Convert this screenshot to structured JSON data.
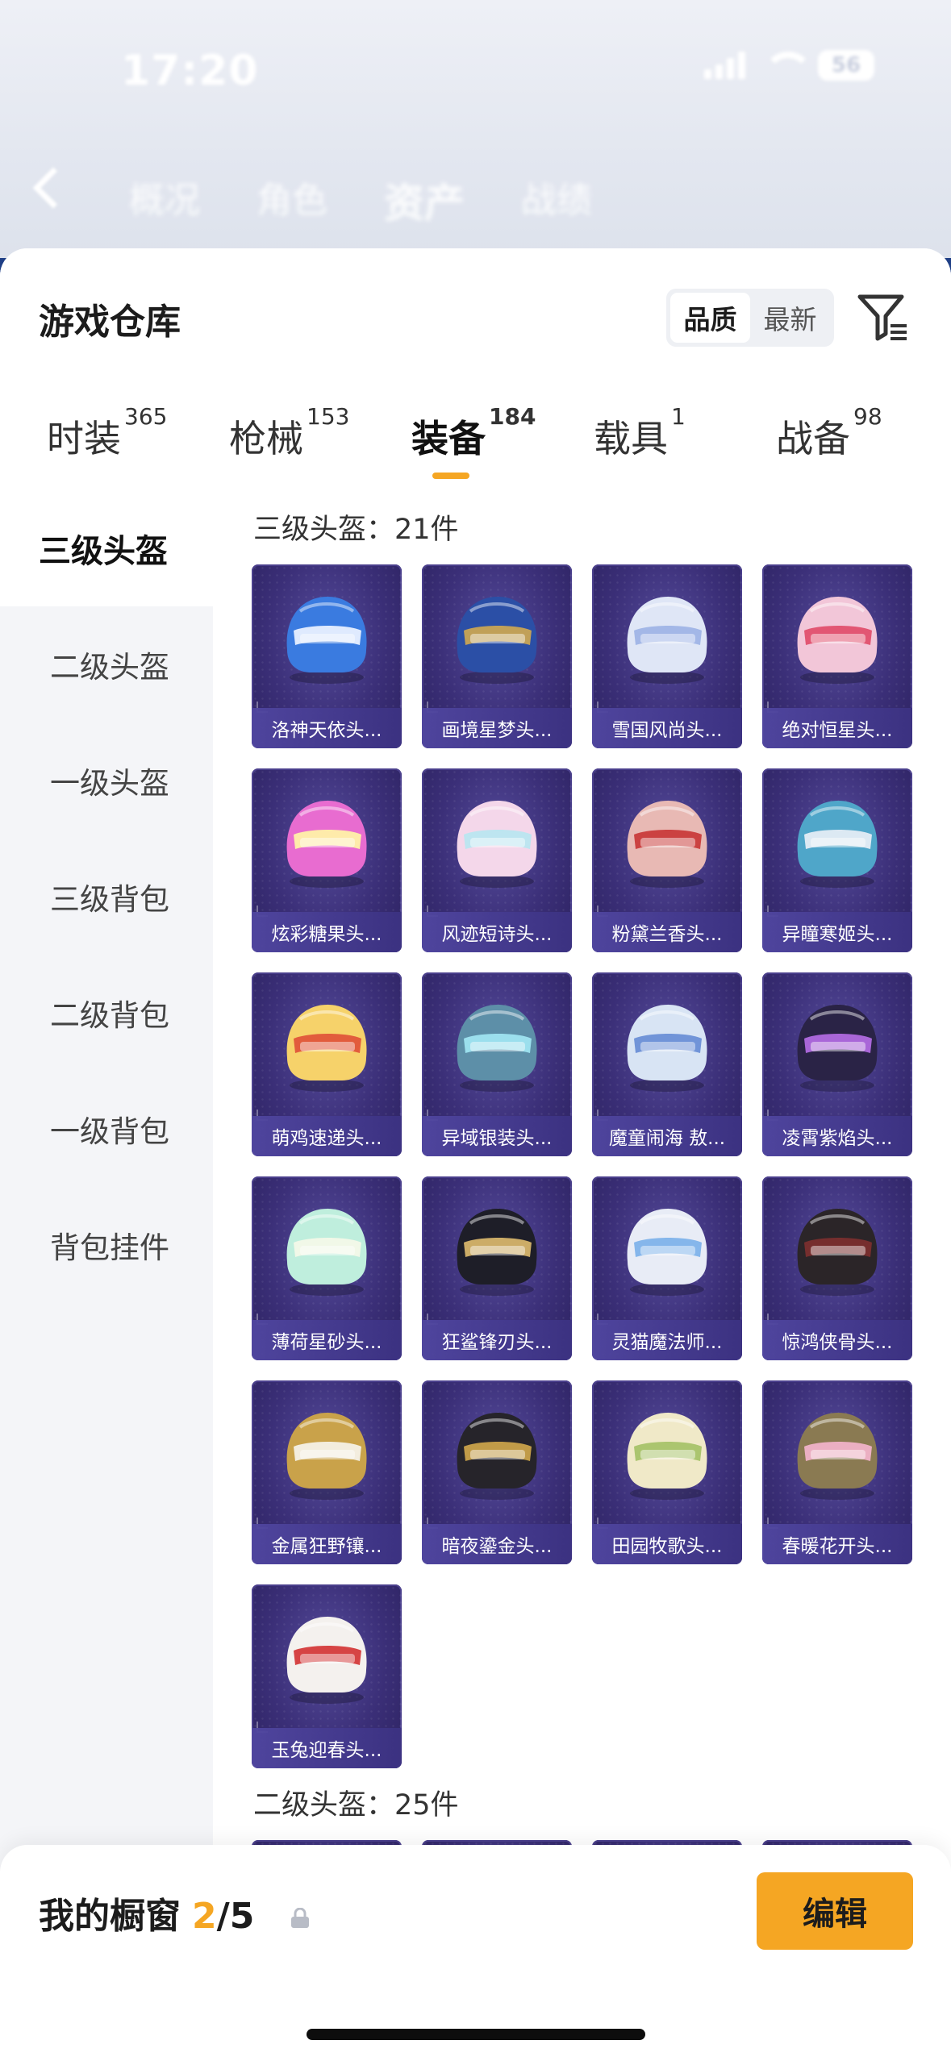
{
  "status_bar": {
    "time": "17:20",
    "battery": "56"
  },
  "background_tabs": [
    "概况",
    "角色",
    "资产",
    "战绩"
  ],
  "sheet": {
    "title": "游戏仓库",
    "sort_options": [
      {
        "label": "品质",
        "active": true
      },
      {
        "label": "最新",
        "active": false
      }
    ],
    "filter_icon": "filter-icon"
  },
  "category_tabs": [
    {
      "label": "时装",
      "count": "365"
    },
    {
      "label": "枪械",
      "count": "153"
    },
    {
      "label": "装备",
      "count": "184",
      "active": true
    },
    {
      "label": "载具",
      "count": "1"
    },
    {
      "label": "战备",
      "count": "98"
    }
  ],
  "side_nav": [
    {
      "label": "三级头盔",
      "active": true
    },
    {
      "label": "二级头盔"
    },
    {
      "label": "一级头盔"
    },
    {
      "label": "三级背包"
    },
    {
      "label": "二级背包"
    },
    {
      "label": "一级背包"
    },
    {
      "label": "背包挂件"
    }
  ],
  "groups": [
    {
      "label": "三级头盔：21件",
      "items": [
        {
          "name": "洛神天依头...",
          "color": "#3a7be0",
          "accent": "#e8f0ff"
        },
        {
          "name": "画境星梦头...",
          "color": "#2b4fa6",
          "accent": "#c9a453"
        },
        {
          "name": "雪国风尚头...",
          "color": "#dfe6f6",
          "accent": "#9fb4e6"
        },
        {
          "name": "绝对恒星头...",
          "color": "#f2c6d8",
          "accent": "#e0506e"
        },
        {
          "name": "炫彩糖果头...",
          "color": "#e86cd0",
          "accent": "#fff2a8"
        },
        {
          "name": "风迹短诗头...",
          "color": "#f4d7ea",
          "accent": "#b9e6f0"
        },
        {
          "name": "粉黛兰香头...",
          "color": "#e8b9b4",
          "accent": "#c93b3b"
        },
        {
          "name": "异瞳寒姬头...",
          "color": "#4fa6c9",
          "accent": "#e4ecf5"
        },
        {
          "name": "萌鸡速递头...",
          "color": "#f6d26a",
          "accent": "#e0553a"
        },
        {
          "name": "异域银装头...",
          "color": "#5d8fa8",
          "accent": "#9ee4f0"
        },
        {
          "name": "魔童闹海 敖...",
          "color": "#d8e4f4",
          "accent": "#6b8fd6"
        },
        {
          "name": "凌霄紫焰头...",
          "color": "#2a2346",
          "accent": "#b06ae0"
        },
        {
          "name": "薄荷星砂头...",
          "color": "#bfeedd",
          "accent": "#f3f8e8"
        },
        {
          "name": "狂鲨锋刃头...",
          "color": "#1e1e28",
          "accent": "#d6b46a"
        },
        {
          "name": "灵猫魔法师...",
          "color": "#e8ecf6",
          "accent": "#7fb3ea"
        },
        {
          "name": "惊鸿侠骨头...",
          "color": "#2b2528",
          "accent": "#7a2e2e"
        },
        {
          "name": "金属狂野镶...",
          "color": "#c9a24a",
          "accent": "#f5f1e6"
        },
        {
          "name": "暗夜鎏金头...",
          "color": "#26242a",
          "accent": "#c9a24a"
        },
        {
          "name": "田园牧歌头...",
          "color": "#f0e9c8",
          "accent": "#a6c36a"
        },
        {
          "name": "春暖花开头...",
          "color": "#8a7a52",
          "accent": "#f0b2c8"
        },
        {
          "name": "玉兔迎春头...",
          "color": "#f4f1ee",
          "accent": "#d43a3a"
        }
      ]
    },
    {
      "label": "二级头盔：25件",
      "items": []
    }
  ],
  "showcase": {
    "title": "我的橱窗",
    "current": "2",
    "separator": "/",
    "total": "5",
    "edit_label": "编辑"
  }
}
